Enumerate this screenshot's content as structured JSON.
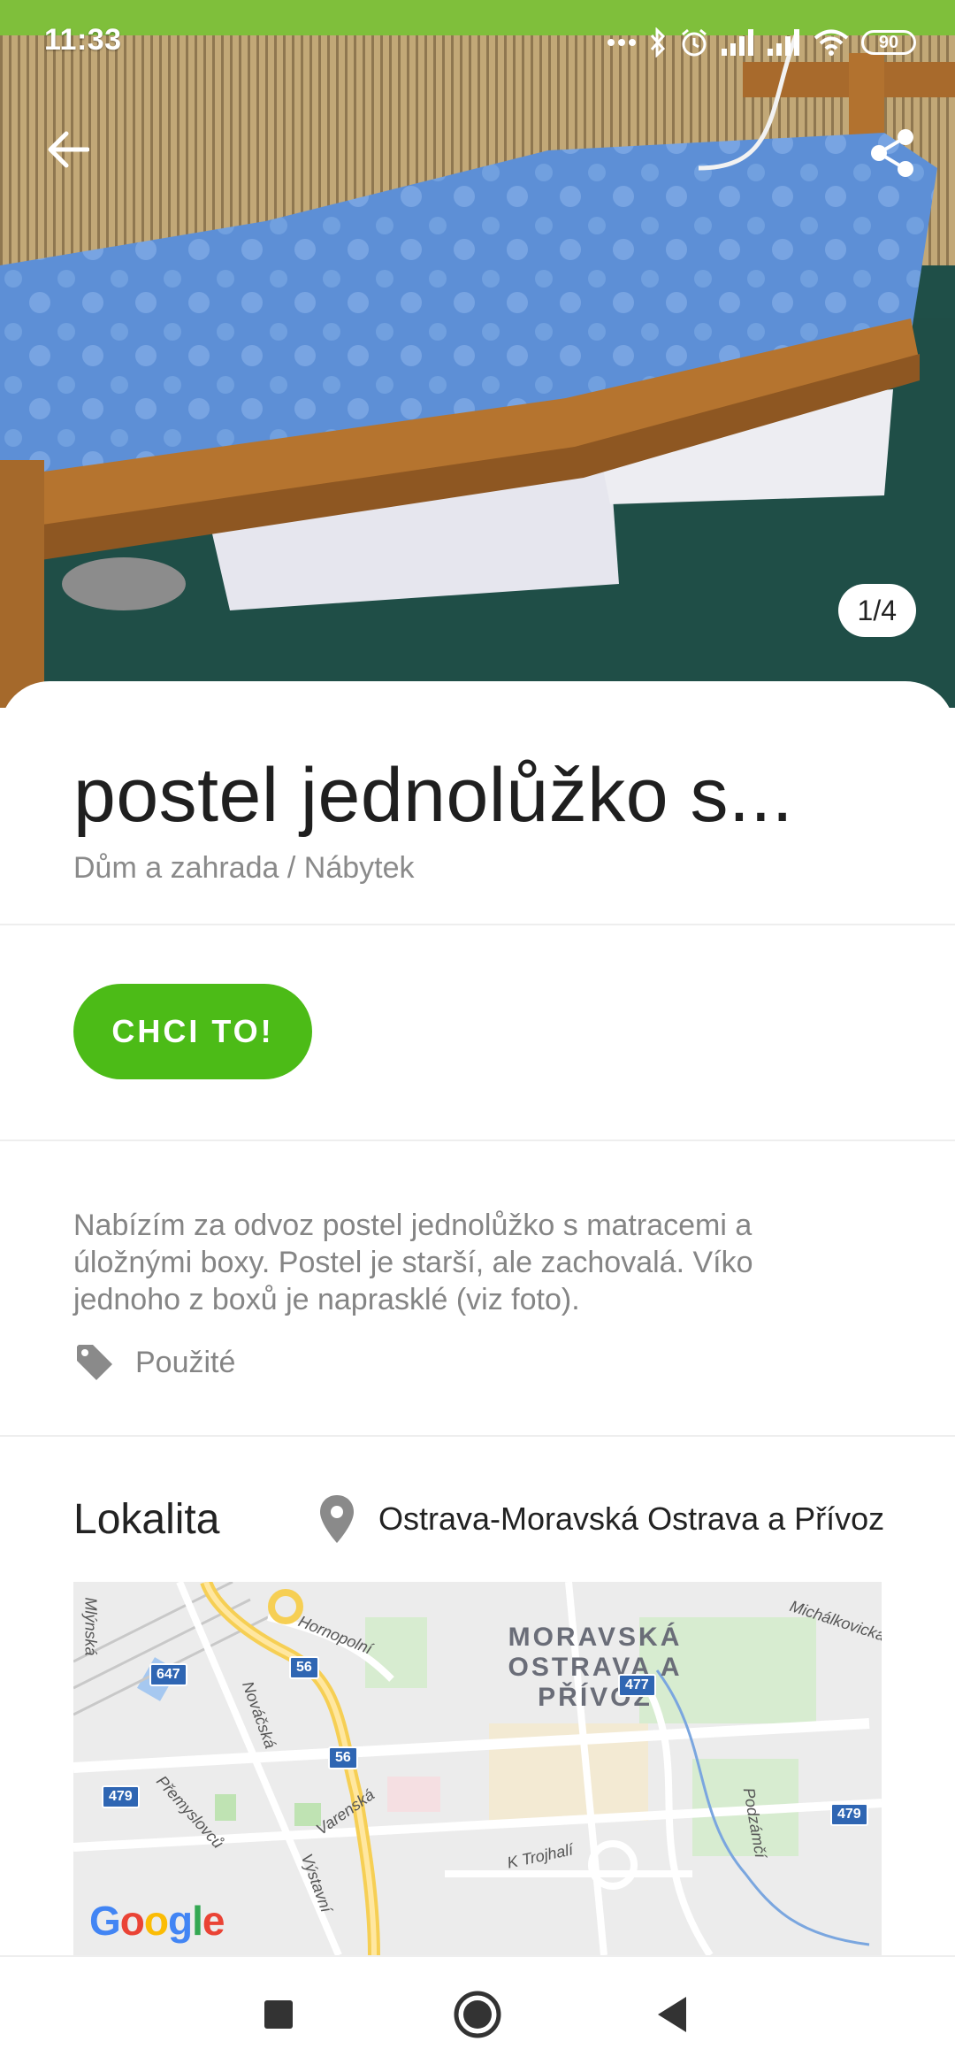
{
  "status_bar": {
    "time": "11:33",
    "battery": "90",
    "icons": [
      "dots-icon",
      "bluetooth-icon",
      "alarm-icon",
      "signal-icon",
      "signal-icon",
      "wifi-icon",
      "battery-icon"
    ]
  },
  "hero": {
    "counter": "1/4",
    "back_icon": "arrow-left-icon",
    "share_icon": "share-icon"
  },
  "listing": {
    "title": "postel jednolůžko s...",
    "category": "Dům a zahrada / Nábytek",
    "cta_label": "CHCI TO!",
    "description": "Nabízím za odvoz postel jednolůžko s matracemi a úložnými boxy. Postel je starší, ale zachovalá. Víko jednoho z boxů je naprasklé (viz foto).",
    "condition": "Použité"
  },
  "location": {
    "title": "Lokalita",
    "place": "Ostrava-Moravská Ostrava a Přívoz",
    "map": {
      "district": "MORAVSKÁ OSTRAVA A PŘÍVOZ",
      "streets": [
        "Hornopolní",
        "Nováčská",
        "Přemyslovců",
        "Varenská",
        "Výstavní",
        "K Trojhalí",
        "Podzámčí",
        "Michálkovická",
        "Mlýnská"
      ],
      "route_shields": [
        "647",
        "56",
        "477",
        "56",
        "479",
        "479"
      ],
      "attribution": "Google"
    }
  },
  "nav_bar": {
    "icons": [
      "recent-apps-icon",
      "home-icon",
      "back-icon"
    ]
  },
  "colors": {
    "accent": "#4cbb17",
    "text_primary": "#1f1f1f",
    "text_secondary": "#858585"
  }
}
